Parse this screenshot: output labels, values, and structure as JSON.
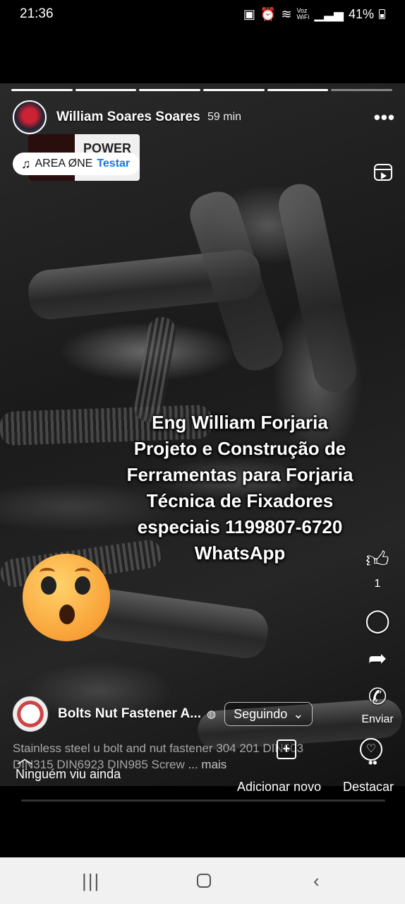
{
  "status_bar": {
    "time": "21:36",
    "battery": "41%",
    "net_label_top": "Voz",
    "net_label_bottom": "WiFi"
  },
  "story": {
    "progress_segments": [
      true,
      true,
      true,
      true,
      true,
      false
    ],
    "author": "William Soares Soares",
    "time_ago": "59 min",
    "music": {
      "thumb_text": "POWER",
      "artist": "AREA ØNE",
      "song": "Testar"
    },
    "overlay_lines": [
      "Eng William Forjaria",
      "Projeto e Construção de",
      "Ferramentas para Forjaria",
      "Técnica de Fixadores",
      "especiais 1199807-6720",
      "WhatsApp"
    ],
    "like_count": "1",
    "share_label": "Enviar",
    "page": {
      "name": "Bolts Nut Fastener A...",
      "follow_label": "Seguindo"
    },
    "caption": "Stainless steel  u bolt and nut fastener 304 201 DIN603 DIN315 DIN6923 DIN985 Screw",
    "caption_more": "... mais"
  },
  "footer": {
    "viewers": "Ninguém viu ainda",
    "add_new": "Adicionar novo",
    "highlight": "Destacar"
  },
  "icons": {
    "music": "music-note-icon",
    "more": "more-dots-icon",
    "reels": "reels-icon",
    "like": "thumbs-up-icon",
    "comment": "comment-icon",
    "share": "share-arrow-icon",
    "whatsapp": "whatsapp-icon",
    "globe": "globe-icon",
    "chevron": "chevron-down-icon",
    "up": "chevron-up-icon",
    "add": "add-icon",
    "highlight": "heart-circle-icon"
  },
  "colors": {
    "link": "#1a73e8",
    "emoji": "#f9a53b"
  }
}
